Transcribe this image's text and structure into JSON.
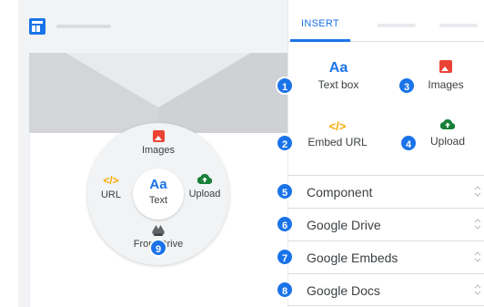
{
  "colors": {
    "accent": "#1a73e8",
    "image_icon": "#ea4335",
    "embed_icon": "#f9ab00",
    "upload_icon": "#188038",
    "drive_icon": "#5f6368"
  },
  "editor": {
    "logo_icon": "sites-layout-icon",
    "radial_menu": {
      "top": {
        "label": "Images",
        "icon": "image-icon"
      },
      "left": {
        "label": "URL",
        "icon": "embed-code-icon"
      },
      "center": {
        "glyph": "Aa",
        "label": "Text",
        "icon": "text-box-icon"
      },
      "right": {
        "label": "Upload",
        "icon": "upload-cloud-icon"
      },
      "bottom": {
        "label": "From Drive",
        "icon": "google-drive-icon"
      },
      "badge": "9"
    }
  },
  "sidebar": {
    "tabs": [
      {
        "label": "INSERT",
        "active": true
      }
    ],
    "insert_grid": [
      {
        "glyph": "Aa",
        "label": "Text box",
        "icon": "text-box-icon",
        "badge": "1"
      },
      {
        "label": "Images",
        "icon": "image-icon",
        "badge": "3"
      },
      {
        "glyph": "</>",
        "label": "Embed URL",
        "icon": "embed-code-icon",
        "badge": "2"
      },
      {
        "label": "Upload",
        "icon": "upload-cloud-icon",
        "badge": "4"
      }
    ],
    "sections": [
      {
        "label": "Component",
        "badge": "5",
        "icon": "unfold-icon"
      },
      {
        "label": "Google Drive",
        "badge": "6",
        "icon": "unfold-icon"
      },
      {
        "label": "Google Embeds",
        "badge": "7",
        "icon": "unfold-icon"
      },
      {
        "label": "Google Docs",
        "badge": "8",
        "icon": "unfold-icon"
      }
    ]
  }
}
